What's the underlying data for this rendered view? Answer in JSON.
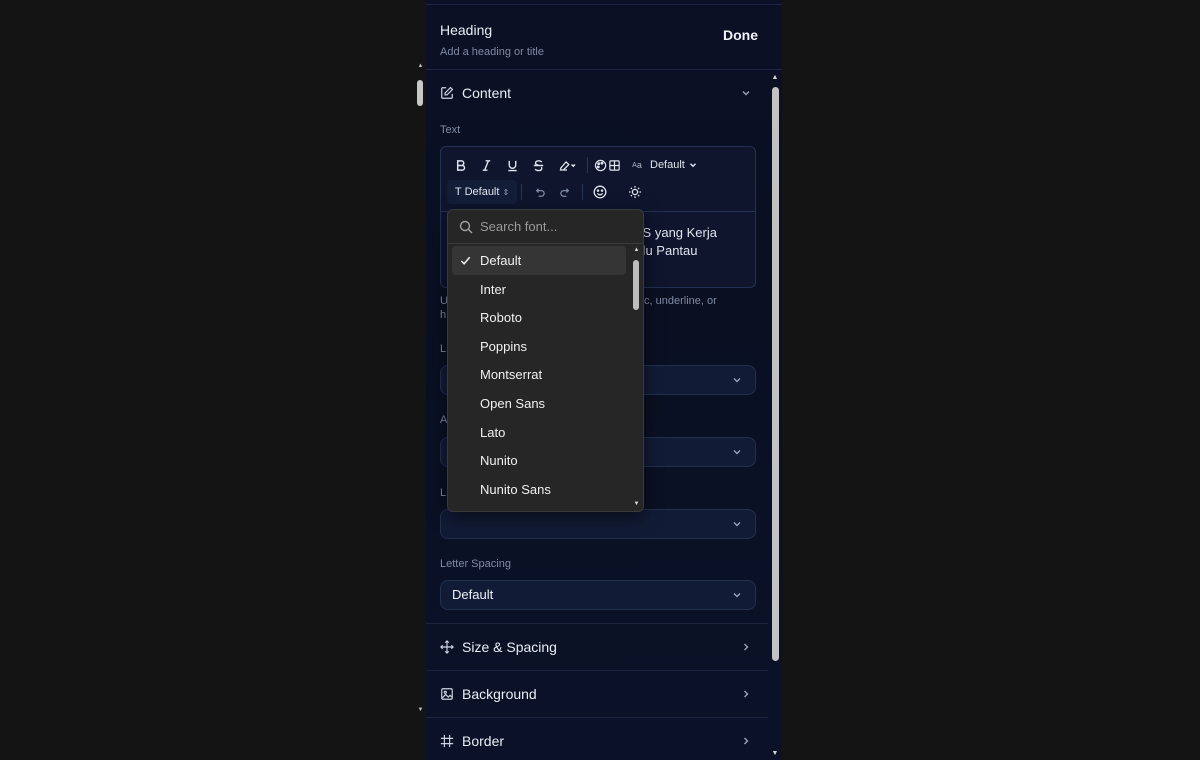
{
  "header": {
    "title": "Heading",
    "subtitle": "Add a heading or title",
    "done_label": "Done"
  },
  "content_section": {
    "label": "Content"
  },
  "text_field": {
    "label": "Text",
    "font_size_value": "Default",
    "font_family_value": "Default",
    "text_line1": "TIS yang Kerja",
    "text_line2": "erlu Pantau",
    "help_visible_1": "U",
    "help_visible_2": "c, underline, or",
    "help_visible_3": "h"
  },
  "hidden_labels": {
    "l1": "L",
    "l2": "A",
    "l3": "L"
  },
  "letter_spacing": {
    "label": "Letter Spacing",
    "value": "Default"
  },
  "sections": [
    {
      "label": "Size & Spacing"
    },
    {
      "label": "Background"
    },
    {
      "label": "Border"
    }
  ],
  "font_dropdown": {
    "search_placeholder": "Search font...",
    "options": [
      {
        "name": "Default",
        "selected": true
      },
      {
        "name": "Inter"
      },
      {
        "name": "Roboto"
      },
      {
        "name": "Poppins"
      },
      {
        "name": "Montserrat"
      },
      {
        "name": "Open Sans"
      },
      {
        "name": "Lato"
      },
      {
        "name": "Nunito"
      },
      {
        "name": "Nunito Sans"
      }
    ]
  },
  "colors": {
    "panel_bg": "#0b1024",
    "dropdown_bg": "#262626",
    "accent_text": "#e9edf5"
  }
}
